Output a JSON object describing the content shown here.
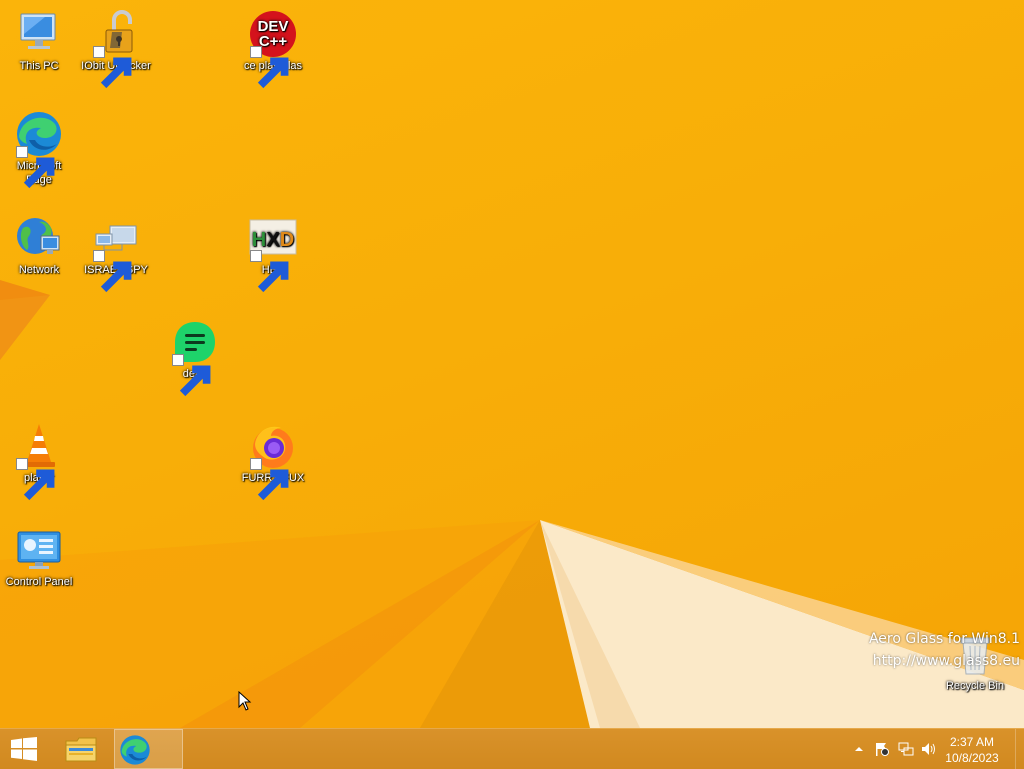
{
  "desktop": {
    "icons": [
      {
        "label": "This PC"
      },
      {
        "label": "IObit Unlocker"
      },
      {
        "label": "ce plas plas"
      },
      {
        "label": "Microsoft Edge"
      },
      {
        "label": "Network"
      },
      {
        "label": "ISRAEL SPY"
      },
      {
        "label": "HEX"
      },
      {
        "label": "dead"
      },
      {
        "label": "player"
      },
      {
        "label": "FURRY FUX"
      },
      {
        "label": "Control Panel"
      },
      {
        "label": "Recycle Bin"
      }
    ],
    "devcpp_text": {
      "line1": "DEV",
      "line2": "C++"
    },
    "hex_text": {
      "h": "H",
      "x": "X",
      "d": "D"
    }
  },
  "watermark": {
    "line1": "Aero Glass for Win8.1",
    "line2": "http://www.glass8.eu"
  },
  "taskbar": {
    "clock_time": "2:37 AM",
    "clock_date": "10/8/2023"
  },
  "colors": {
    "wallpaper": "#f8ae08",
    "taskbar": "#d68d26"
  }
}
